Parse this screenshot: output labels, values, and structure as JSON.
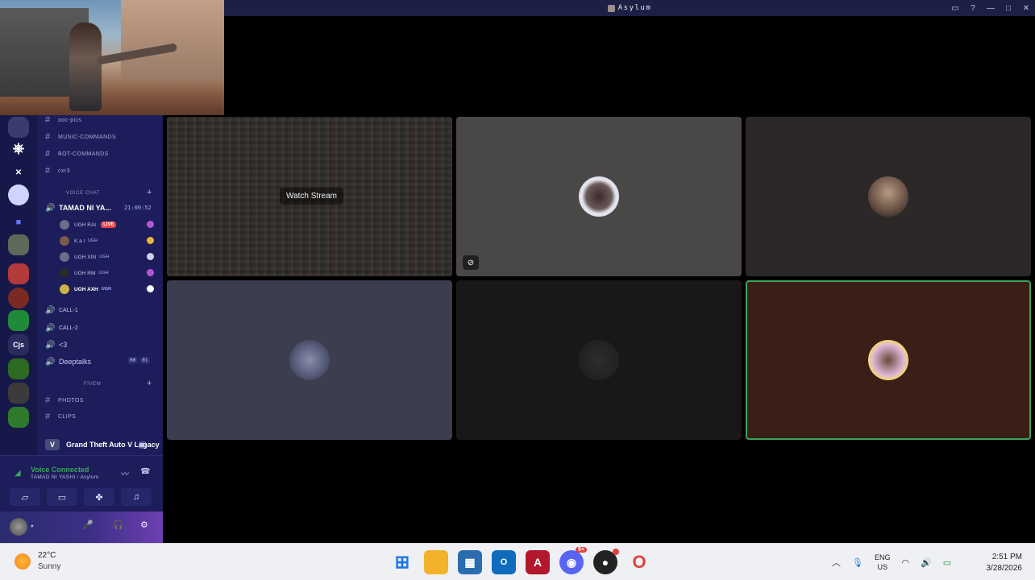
{
  "window": {
    "title": "Asylum",
    "buttons": [
      "inbox",
      "help",
      "minimize",
      "maximize",
      "close"
    ]
  },
  "sidebar": {
    "text_channels_top": [
      "ooc-pics",
      "MUSIC-COMMANDS",
      "BOT-COMMANDS",
      "cxr3"
    ],
    "voice_category": "VOICE CHAT",
    "active_voice": {
      "name": "TAMAD NI YA...",
      "timer": "21:00:52",
      "members": [
        {
          "name": "UGH RAI",
          "tag": "",
          "live": "LIVE"
        },
        {
          "name": "K a l",
          "tag": "UGH",
          "live": ""
        },
        {
          "name": "UGH XIN",
          "tag": "UGH",
          "live": ""
        },
        {
          "name": "UGH RM",
          "tag": "UGH",
          "live": ""
        },
        {
          "name": "UGH AXH",
          "tag": "UGH",
          "live": ""
        }
      ]
    },
    "other_voice": [
      "CALL-1",
      "CALL-2",
      "<3",
      "Deeptalks"
    ],
    "deeptalks_counter": [
      "00",
      "01"
    ],
    "fivem_category": "FIVEM",
    "fivem_channels": [
      "PHOTOS",
      "CLIPS"
    ]
  },
  "activity": {
    "game": "Grand Theft Auto V Legacy"
  },
  "voice_panel": {
    "status": "Voice Connected",
    "location": "TAMAD NI YASHI / Asylum"
  },
  "stage": {
    "watch_stream": "Watch Stream"
  },
  "taskbar": {
    "temperature": "22°C",
    "condition": "Sunny",
    "discord_badge": "9+",
    "lang": "ENG",
    "region": "US",
    "time": "2:51 PM",
    "date": "3/28/2026"
  },
  "colors": {
    "sidebar_bg": "#1c1d5a",
    "titlebar_bg": "#1e1f45",
    "speaking_border": "#3ba55d",
    "live_badge": "#ed4245",
    "voice_connected": "#3ba55d"
  }
}
